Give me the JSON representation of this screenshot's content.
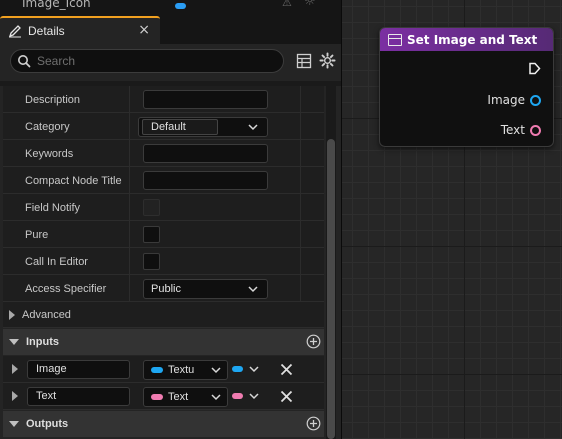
{
  "top_strip": {
    "label": "Image_Icon"
  },
  "details_tab": {
    "title": "Details",
    "close_glyph": "×",
    "icon": "pencil-icon"
  },
  "search": {
    "placeholder": "Search",
    "value": ""
  },
  "toolbar": {
    "table_view_icon": "table-icon",
    "settings_icon": "gear-icon"
  },
  "properties": [
    {
      "label": "Description",
      "widget": "text",
      "value": ""
    },
    {
      "label": "Category",
      "widget": "category-combo",
      "value": "Default"
    },
    {
      "label": "Keywords",
      "widget": "text",
      "value": ""
    },
    {
      "label": "Compact Node Title",
      "widget": "text",
      "value": ""
    },
    {
      "label": "Field Notify",
      "widget": "checkbox",
      "checked": false,
      "enabled": false
    },
    {
      "label": "Pure",
      "widget": "checkbox",
      "checked": false,
      "enabled": true
    },
    {
      "label": "Call In Editor",
      "widget": "checkbox",
      "checked": false,
      "enabled": true
    },
    {
      "label": "Access Specifier",
      "widget": "combo",
      "value": "Public"
    }
  ],
  "sections": {
    "advanced": "Advanced",
    "inputs": "Inputs",
    "outputs": "Outputs"
  },
  "inputs": [
    {
      "name": "Image",
      "type": "Textu",
      "color": "#1ea7f2"
    },
    {
      "name": "Text",
      "type": "Text",
      "color": "#f07cb1"
    }
  ],
  "node": {
    "title": "Set Image and Text",
    "header_color": "#7b2fa2",
    "pins": [
      {
        "label": "Image",
        "color": "#1ea7f2"
      },
      {
        "label": "Text",
        "color": "#f07cb1"
      }
    ]
  },
  "colors": {
    "panel_bg": "#242424",
    "row_bg": "#1e1e1e",
    "section_bg": "#333333",
    "tab_accent": "#f0a020",
    "graph_bg": "#262626"
  }
}
